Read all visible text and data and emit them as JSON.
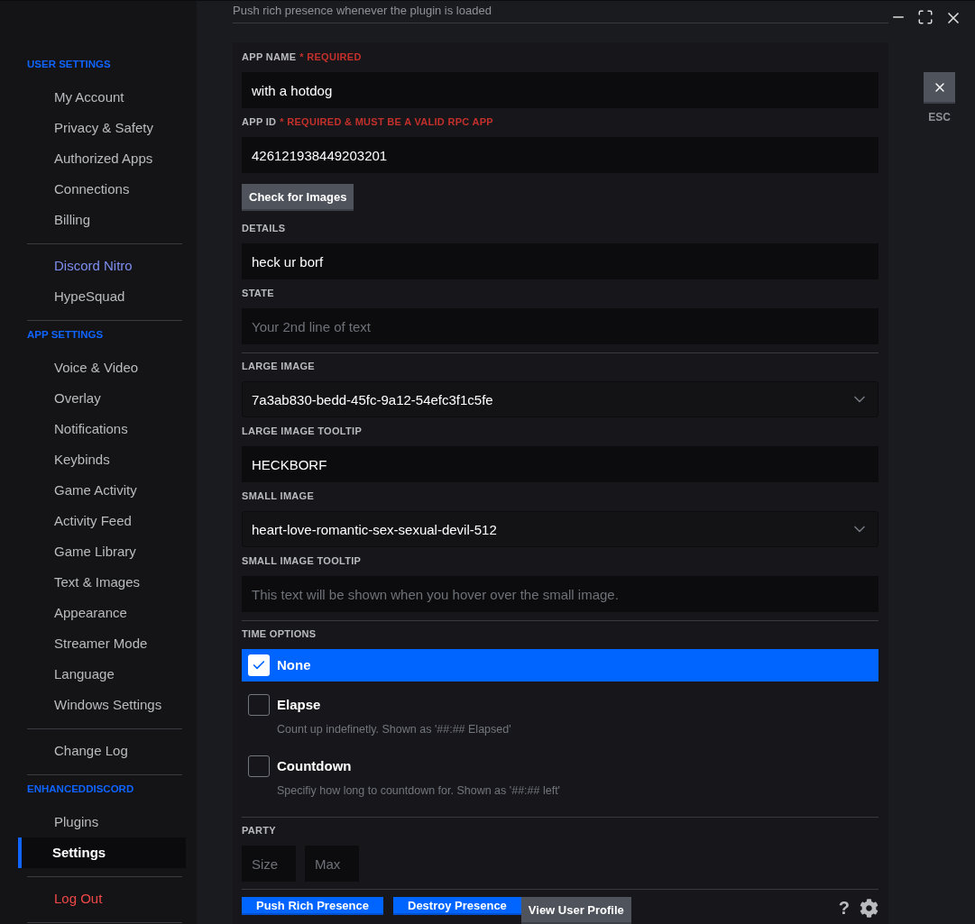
{
  "sidebar": {
    "sections": [
      {
        "header": "USER SETTINGS",
        "items": [
          {
            "label": "My Account",
            "kind": "normal",
            "selected": false
          },
          {
            "label": "Privacy & Safety",
            "kind": "normal",
            "selected": false
          },
          {
            "label": "Authorized Apps",
            "kind": "normal",
            "selected": false
          },
          {
            "label": "Connections",
            "kind": "normal",
            "selected": false
          },
          {
            "label": "Billing",
            "kind": "normal",
            "selected": false
          }
        ]
      },
      {
        "items": [
          {
            "label": "Discord Nitro",
            "kind": "nitro",
            "selected": false
          },
          {
            "label": "HypeSquad",
            "kind": "normal",
            "selected": false
          }
        ]
      },
      {
        "header": "APP SETTINGS",
        "items": [
          {
            "label": "Voice & Video",
            "kind": "normal",
            "selected": false
          },
          {
            "label": "Overlay",
            "kind": "normal",
            "selected": false
          },
          {
            "label": "Notifications",
            "kind": "normal",
            "selected": false
          },
          {
            "label": "Keybinds",
            "kind": "normal",
            "selected": false
          },
          {
            "label": "Game Activity",
            "kind": "normal",
            "selected": false
          },
          {
            "label": "Activity Feed",
            "kind": "normal",
            "selected": false
          },
          {
            "label": "Game Library",
            "kind": "normal",
            "selected": false
          },
          {
            "label": "Text & Images",
            "kind": "normal",
            "selected": false
          },
          {
            "label": "Appearance",
            "kind": "normal",
            "selected": false
          },
          {
            "label": "Streamer Mode",
            "kind": "normal",
            "selected": false
          },
          {
            "label": "Language",
            "kind": "normal",
            "selected": false
          },
          {
            "label": "Windows Settings",
            "kind": "normal",
            "selected": false
          }
        ]
      },
      {
        "items": [
          {
            "label": "Change Log",
            "kind": "normal",
            "selected": false
          }
        ]
      },
      {
        "header": "ENHANCEDDISCORD",
        "items": [
          {
            "label": "Plugins",
            "kind": "normal",
            "selected": false
          },
          {
            "label": "Settings",
            "kind": "normal",
            "selected": true
          }
        ]
      },
      {
        "items": [
          {
            "label": "Log Out",
            "kind": "danger",
            "selected": false
          }
        ]
      }
    ]
  },
  "intro": "Push rich presence whenever the plugin is loaded",
  "close": {
    "label": "ESC"
  },
  "form": {
    "groups": [
      [
        {
          "kind": "input",
          "label": "APP NAME",
          "note": "* REQUIRED",
          "value": "with a hotdog"
        },
        {
          "kind": "input",
          "label": "APP ID",
          "note": "* REQUIRED & MUST BE A VALID RPC APP",
          "value": "426121938449203201"
        },
        {
          "kind": "button",
          "text": "Check for Images"
        },
        {
          "kind": "input",
          "label": "DETAILS",
          "value": "heck ur borf"
        },
        {
          "kind": "input",
          "label": "STATE",
          "placeholder": "Your 2nd line of text"
        }
      ],
      [
        {
          "kind": "select",
          "label": "LARGE IMAGE",
          "value": "7a3ab830-bedd-45fc-9a12-54efc3f1c5fe"
        },
        {
          "kind": "input",
          "label": "LARGE IMAGE TOOLTIP",
          "value": "HECKBORF"
        },
        {
          "kind": "select",
          "label": "SMALL IMAGE",
          "value": "heart-love-romantic-sex-sexual-devil-512"
        },
        {
          "kind": "input",
          "label": "SMALL IMAGE TOOLTIP",
          "placeholder": "This text will be shown when you hover over the small image."
        }
      ]
    ],
    "time_options": {
      "label": "TIME OPTIONS",
      "options": [
        {
          "label": "None",
          "selected": true
        },
        {
          "label": "Elapse",
          "description": "Count up indefinetly. Shown as '##:## Elapsed'",
          "selected": false
        },
        {
          "label": "Countdown",
          "description": "Specifiy how long to countdown for. Shown as '##:## left'",
          "selected": false
        }
      ]
    },
    "party": {
      "label": "PARTY",
      "fields": [
        {
          "placeholder": "Size"
        },
        {
          "placeholder": "Max"
        }
      ]
    }
  },
  "footer": {
    "buttons": [
      {
        "kind": "primary",
        "text": "Push Rich Presence"
      },
      {
        "kind": "primary",
        "text": "Destroy Presence"
      },
      {
        "kind": "secondary",
        "text": "View User Profile"
      }
    ],
    "help": "?"
  }
}
